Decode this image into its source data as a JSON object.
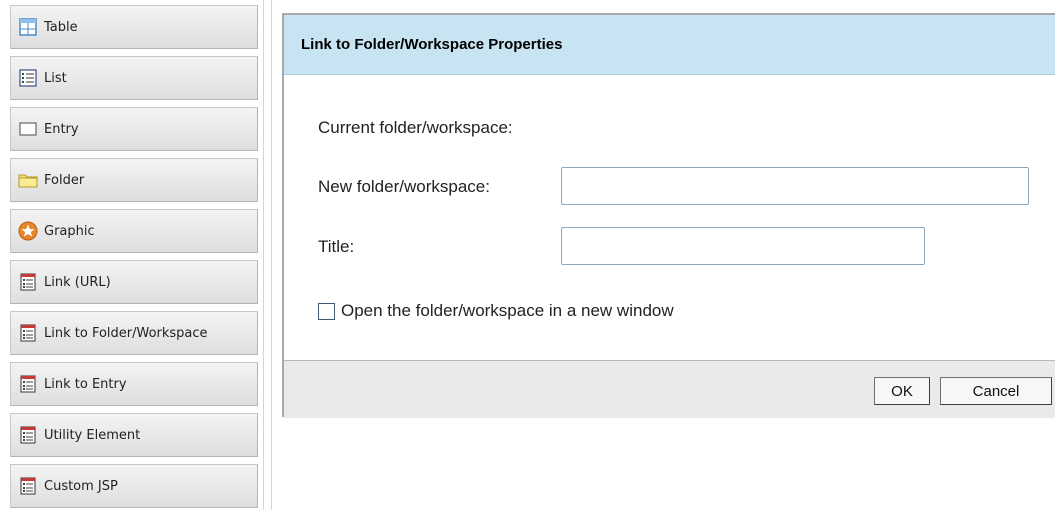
{
  "palette": {
    "items": [
      {
        "label": "Table",
        "icon": "table-icon"
      },
      {
        "label": "List",
        "icon": "list-icon"
      },
      {
        "label": "Entry",
        "icon": "entry-icon"
      },
      {
        "label": "Folder",
        "icon": "folder-icon"
      },
      {
        "label": "Graphic",
        "icon": "graphic-star-icon"
      },
      {
        "label": "Link (URL)",
        "icon": "link-url-icon"
      },
      {
        "label": "Link to Folder/Workspace",
        "icon": "link-folder-icon"
      },
      {
        "label": "Link to Entry",
        "icon": "link-entry-icon"
      },
      {
        "label": "Utility Element",
        "icon": "utility-element-icon"
      },
      {
        "label": "Custom JSP",
        "icon": "custom-jsp-icon"
      }
    ]
  },
  "dialog": {
    "title": "Link to Folder/Workspace Properties",
    "current_label": "Current folder/workspace:",
    "new_label": "New folder/workspace:",
    "new_value": "",
    "title_label": "Title:",
    "title_value": "",
    "checkbox_label": "Open the folder/workspace in a new window",
    "checkbox_checked": false,
    "ok_label": "OK",
    "cancel_label": "Cancel"
  },
  "colors": {
    "header_bg": "#c8e3f2",
    "footer_bg": "#eaeaea",
    "input_border": "#8fa9c1"
  }
}
